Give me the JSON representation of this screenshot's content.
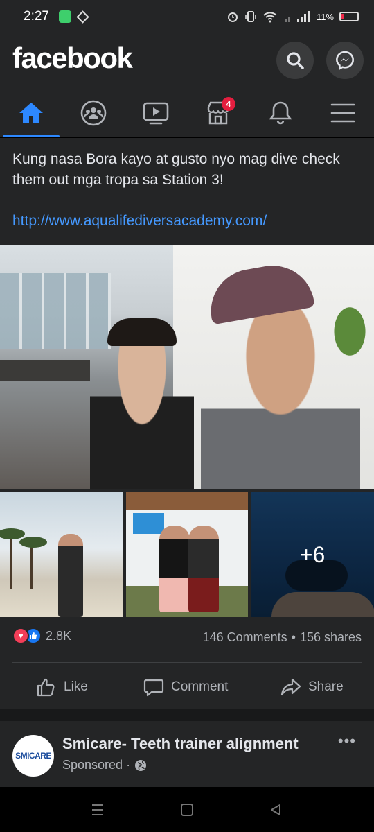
{
  "status_bar": {
    "time": "2:27",
    "battery": "11%"
  },
  "header": {
    "logo": "facebook"
  },
  "tabs": {
    "notifications_badge": "4"
  },
  "post": {
    "text": "Kung nasa Bora kayo at gusto nyo mag dive check them out mga tropa sa Station 3!",
    "link": "http://www.aqualifediversacademy.com/",
    "more_photos": "+6",
    "reaction_count": "2.8K",
    "comments": "146 Comments",
    "shares": "156 shares",
    "actions": {
      "like": "Like",
      "comment": "Comment",
      "share": "Share"
    }
  },
  "sponsored_post": {
    "avatar_text": "SMICARE",
    "title": "Smicare- Teeth trainer alignment",
    "subtitle": "Sponsored ·",
    "more": "•••"
  },
  "colors": {
    "accent": "#2d88ff",
    "link": "#4599ff",
    "badge": "#e41e3f"
  },
  "icons": [
    "search-icon",
    "messenger-icon",
    "home-icon",
    "groups-icon",
    "watch-icon",
    "marketplace-icon",
    "bell-icon",
    "menu-icon",
    "like-icon",
    "comment-icon",
    "share-icon",
    "globe-icon"
  ]
}
